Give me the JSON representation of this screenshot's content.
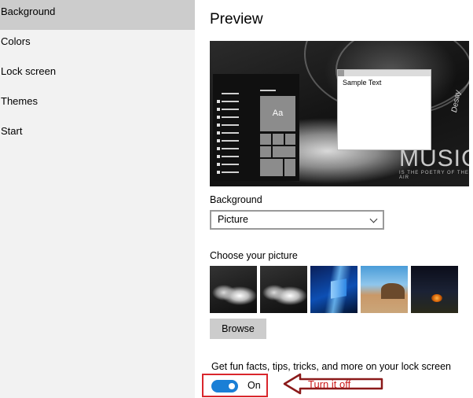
{
  "sidebar": {
    "items": [
      {
        "label": "Background",
        "selected": true
      },
      {
        "label": "Colors"
      },
      {
        "label": "Lock screen"
      },
      {
        "label": "Themes"
      },
      {
        "label": "Start"
      }
    ]
  },
  "preview": {
    "title": "Preview",
    "tile_label": "Aa",
    "window_text": "Sample Text",
    "wallpaper_text": "MUSIC",
    "wallpaper_subtext": "IS THE POETRY OF THE AIR",
    "signature": "Desay"
  },
  "background": {
    "label": "Background",
    "selected": "Picture"
  },
  "choose_picture": {
    "label": "Choose your picture",
    "thumbnails": [
      "headphones-1",
      "headphones-2",
      "windows-10",
      "beach-rocks",
      "night-sky-tent"
    ]
  },
  "browse_label": "Browse",
  "lock_screen_tips": {
    "label": "Get fun facts, tips, tricks, and more on your lock screen",
    "toggle_state": "On",
    "toggle_on": true
  },
  "annotation": {
    "text": "Turn it off",
    "color": "#cc1a1a"
  },
  "colors": {
    "accent": "#1a7fd6",
    "highlight_box": "#d9262c",
    "selected_nav": "#cccccc",
    "sidebar_bg": "#f2f2f2"
  }
}
